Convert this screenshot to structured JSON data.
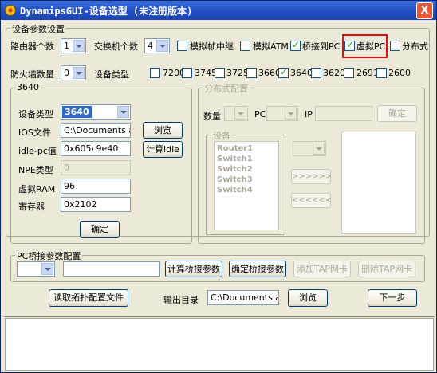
{
  "window": {
    "title": "DynamipsGUI-设备选型 (未注册版本)",
    "close_glyph": "X"
  },
  "device_params": {
    "group_label": "设备参数设置",
    "router_count_label": "路由器个数",
    "router_count": "1",
    "switch_count_label": "交换机个数",
    "switch_count": "4",
    "options": [
      {
        "label": "模拟帧中继",
        "checked": false
      },
      {
        "label": "模拟ATM",
        "checked": false
      },
      {
        "label": "桥接到PC",
        "checked": true
      },
      {
        "label": "虚拟PC",
        "checked": true
      },
      {
        "label": "分布式",
        "checked": false
      }
    ],
    "firewall_label": "防火墙数量",
    "firewall_count": "0",
    "device_type_label": "设备类型",
    "models": [
      {
        "label": "7200",
        "checked": false
      },
      {
        "label": "3745",
        "checked": false
      },
      {
        "label": "3725",
        "checked": false
      },
      {
        "label": "3660",
        "checked": false
      },
      {
        "label": "3640",
        "checked": true
      },
      {
        "label": "3620",
        "checked": false
      },
      {
        "label": "2691",
        "checked": false
      },
      {
        "label": "2600",
        "checked": false
      }
    ]
  },
  "model_panel": {
    "group_label": "3640",
    "device_type_label": "设备类型",
    "device_type_value": "3640",
    "ios_label": "IOS文件",
    "ios_value": "C:\\Documents and",
    "browse_label": "浏览",
    "idle_label": "idle-pc值",
    "idle_value": "0x605c9e40",
    "calc_idle_label": "计算idle",
    "npe_label": "NPE类型",
    "npe_value": "0",
    "ram_label": "虚拟RAM",
    "ram_value": "96",
    "register_label": "寄存器",
    "register_value": "0x2102",
    "ok_label": "确定"
  },
  "distributed": {
    "group_label": "分布式配置",
    "count_label": "数量",
    "pc_label": "PC",
    "ip_label": "IP",
    "ok_label": "确定",
    "devices_label": "设备",
    "devices": [
      "Router1",
      "Switch1",
      "Switch2",
      "Switch3",
      "Switch4"
    ],
    "move_right_label": ">>>>>>",
    "move_left_label": "<<<<<<"
  },
  "bridge": {
    "group_label": "PC桥接参数配置",
    "calc_label": "计算桥接参数",
    "confirm_label": "确定桥接参数",
    "add_tap_label": "添加TAP网卡",
    "del_tap_label": "删除TAP网卡"
  },
  "footer": {
    "read_topology_label": "读取拓扑配置文件",
    "output_dir_label": "输出目录",
    "output_dir_value": "C:\\Documents and",
    "browse_label": "浏览",
    "next_label": "下一步"
  },
  "colors": {
    "titlebar": "#2453c8",
    "highlight": "#e01010",
    "check": "#21a121",
    "selected_combo": "#316ac5"
  }
}
